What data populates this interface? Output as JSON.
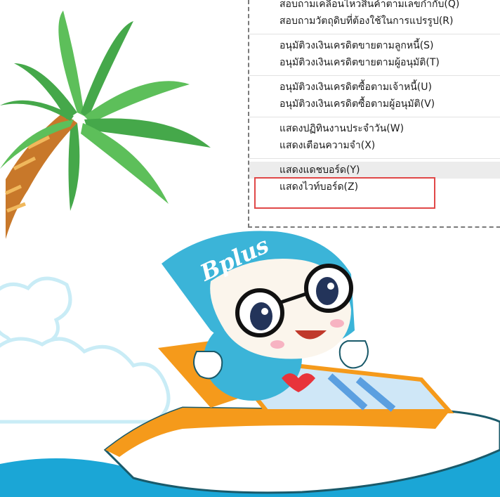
{
  "menu": {
    "groups": [
      {
        "items": [
          {
            "label": "สอบถามเคลื่อนไหวสินค้าตามเลขกำกับ(Q)"
          },
          {
            "label": "สอบถามวัตถุดิบที่ต้องใช้ในการแปรรูป(R)"
          }
        ]
      },
      {
        "items": [
          {
            "label": "อนุมัติวงเงินเครดิตขายตามลูกหนี้(S)"
          },
          {
            "label": "อนุมัติวงเงินเครดิตขายตามผู้อนุมัติ(T)"
          }
        ]
      },
      {
        "items": [
          {
            "label": "อนุมัติวงเงินเครดิตซื้อตามเจ้าหนี้(U)"
          },
          {
            "label": "อนุมัติวงเงินเครดิตซื้อตามผู้อนุมัติ(V)"
          }
        ]
      },
      {
        "items": [
          {
            "label": "แสดงปฏิทินงานประจำวัน(W)"
          },
          {
            "label": "แสดงเตือนความจำ(X)"
          }
        ]
      },
      {
        "items": [
          {
            "label": "แสดงแดชบอร์ด(Y)"
          },
          {
            "label": "แสดงไวท์บอร์ด(Z)"
          }
        ]
      }
    ],
    "highlighted_item": "แสดงแดชบอร์ด(Y)"
  },
  "mascot": {
    "cap_logo_text": "Bplus"
  },
  "colors": {
    "highlight_border": "#e04848",
    "mascot_cap": "#3bb4d8",
    "boat_trim": "#f59a1b",
    "sea": "#1ba6d6",
    "palm_leaf": "#5dbf5a",
    "cloud": "#c9ecf6"
  }
}
